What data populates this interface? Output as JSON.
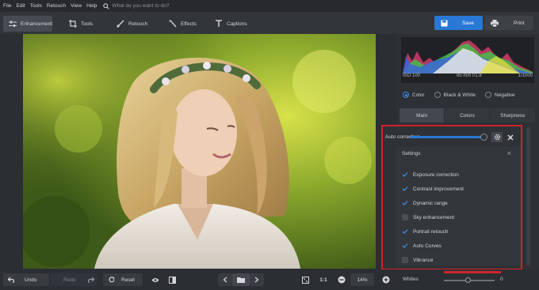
{
  "menu": {
    "items": [
      "File",
      "Edit",
      "Tools",
      "Retouch",
      "View",
      "Help"
    ],
    "search_placeholder": "What do you want to do?"
  },
  "toolbar": {
    "tabs": [
      {
        "label": "Enhancement",
        "icon": "sliders-icon"
      },
      {
        "label": "Tools",
        "icon": "crop-icon"
      },
      {
        "label": "Retouch",
        "icon": "brush-icon"
      },
      {
        "label": "Effects",
        "icon": "magic-wand-icon"
      },
      {
        "label": "Captions",
        "icon": "text-icon"
      }
    ],
    "save_label": "Save",
    "print_label": "Print"
  },
  "photo": {
    "description_icon": "portrait-photo"
  },
  "histogram": {
    "iso": "ISO 100",
    "lens": "85 mm f/1.8",
    "shutter": "1/1000"
  },
  "modes": {
    "options": [
      "Color",
      "Black & White",
      "Negative"
    ],
    "selected": "Color"
  },
  "subtabs": [
    "Main",
    "Colors",
    "Sharpness"
  ],
  "auto_correction": {
    "label": "Auto correction",
    "value_fraction": 0.93
  },
  "settings": {
    "title": "Settings",
    "options": [
      {
        "label": "Exposure correction",
        "checked": true
      },
      {
        "label": "Contrast improvement",
        "checked": true
      },
      {
        "label": "Dynamic range",
        "checked": true
      },
      {
        "label": "Sky enhancement",
        "checked": false
      },
      {
        "label": "Portrait retouch",
        "checked": true
      },
      {
        "label": "Auto Curves",
        "checked": true
      },
      {
        "label": "Vibrance",
        "checked": false
      }
    ]
  },
  "bottom": {
    "undo_label": "Undo",
    "redo_label": "Redo",
    "reset_label": "Reset",
    "zoom_ratio": "1:1",
    "zoom_percent": "14%"
  },
  "whites": {
    "label": "Whites",
    "value": "0"
  },
  "colors": {
    "accent": "#2a78d6",
    "highlight_frame": "#d2232a"
  }
}
